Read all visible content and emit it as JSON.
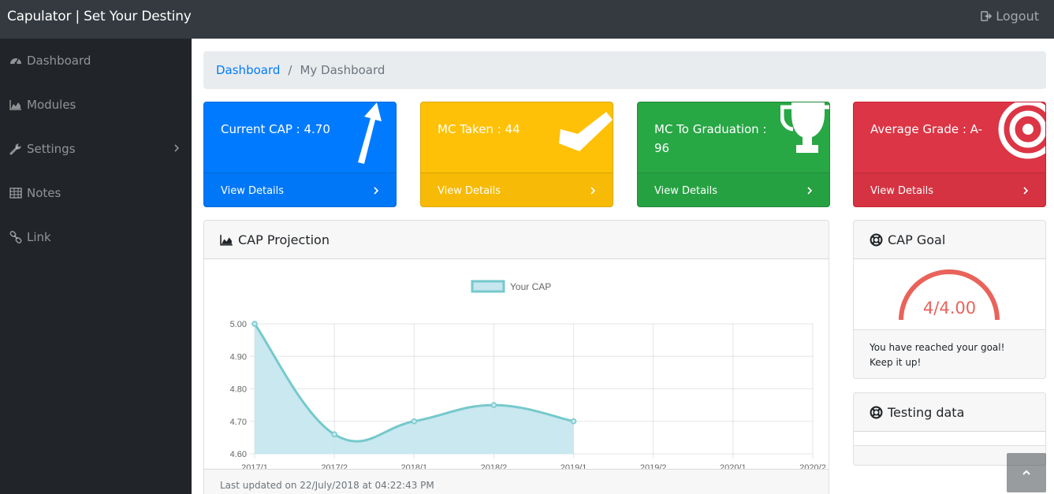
{
  "app": {
    "brand": "Capulator | Set Your Destiny",
    "logout_label": "Logout"
  },
  "sidebar": {
    "items": [
      {
        "label": "Dashboard",
        "icon": "tachometer-icon"
      },
      {
        "label": "Modules",
        "icon": "area-chart-icon"
      },
      {
        "label": "Settings",
        "icon": "wrench-icon",
        "has_submenu": true
      },
      {
        "label": "Notes",
        "icon": "table-icon"
      },
      {
        "label": "Link",
        "icon": "link-icon"
      }
    ]
  },
  "breadcrumb": {
    "link": "Dashboard",
    "separator": "/",
    "active": "My Dashboard"
  },
  "cards": [
    {
      "label": "Current CAP : 4.70",
      "footer": "View Details",
      "color": "#007bff",
      "icon": "arrow-up-icon"
    },
    {
      "label": "MC Taken : 44",
      "footer": "View Details",
      "color": "#ffc107",
      "icon": "check-icon"
    },
    {
      "label": "MC To Graduation : 96",
      "footer": "View Details",
      "color": "#28a745",
      "icon": "trophy-icon"
    },
    {
      "label": "Average Grade : A-",
      "footer": "View Details",
      "color": "#dc3545",
      "icon": "bullseye-icon"
    }
  ],
  "projection": {
    "title": "CAP Projection",
    "footer": "Last updated on 22/July/2018 at 04:22:43 PM"
  },
  "chart_data": {
    "type": "area",
    "categories": [
      "2017/1",
      "2017/2",
      "2018/1",
      "2018/2",
      "2019/1",
      "2019/2",
      "2020/1",
      "2020/2"
    ],
    "series": [
      {
        "name": "Your CAP",
        "values": [
          5.0,
          4.66,
          4.7,
          4.75,
          4.7,
          null,
          null,
          null
        ],
        "color": "#75c9cc",
        "fill": "#c6e7ef"
      }
    ],
    "yticks": [
      "5.00",
      "4.90",
      "4.80",
      "4.70",
      "4.60"
    ],
    "ylim": [
      4.6,
      5.0
    ],
    "grid": true,
    "legend": "top-center"
  },
  "goal": {
    "title": "CAP Goal",
    "value": "4/4.00",
    "progress": 1.0,
    "color": "#e9635a",
    "message": "You have reached your goal! Keep it up!"
  },
  "testing": {
    "title": "Testing data"
  }
}
